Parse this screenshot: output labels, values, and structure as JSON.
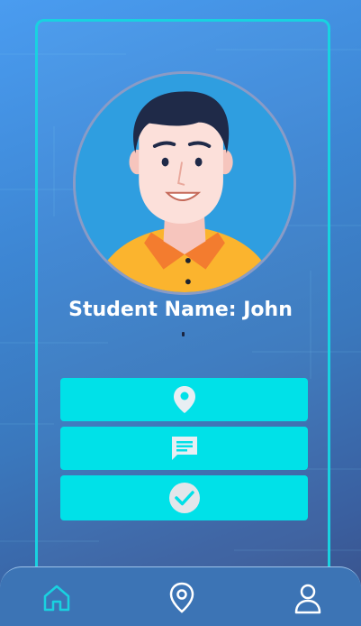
{
  "profile": {
    "student_name": "Student Name: John"
  },
  "actions": [
    {
      "icon": "location-pin-icon"
    },
    {
      "icon": "message-icon"
    },
    {
      "icon": "check-circle-icon"
    }
  ],
  "bottom_nav": {
    "items": [
      {
        "icon": "home-icon",
        "active": true
      },
      {
        "icon": "map-pin-icon",
        "active": false
      },
      {
        "icon": "profile-icon",
        "active": false
      }
    ]
  },
  "colors": {
    "accent": "#00e1e8",
    "card_border": "#19d2e0",
    "nav_background": "#3c74b5",
    "active_nav_icon": "#19d2e0"
  }
}
